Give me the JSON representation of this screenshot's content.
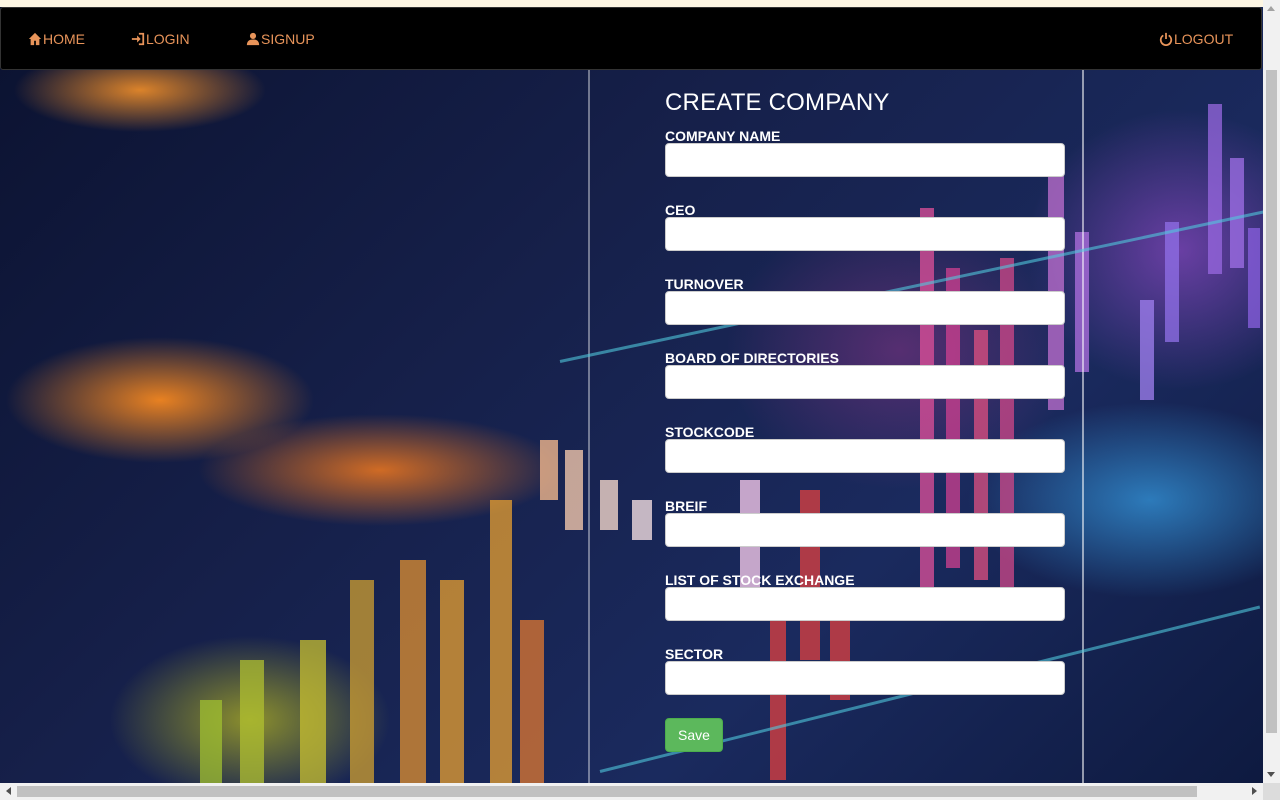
{
  "nav": {
    "home_label": "HOME",
    "login_label": "LOGIN",
    "signup_label": "SIGNUP",
    "logout_label": "LOGOUT",
    "link_color": "#e8945a",
    "icons": [
      "home-icon",
      "login-icon",
      "user-icon",
      "power-icon"
    ]
  },
  "form": {
    "title": "CREATE COMPANY",
    "fields": [
      {
        "label": "COMPANY NAME",
        "value": ""
      },
      {
        "label": "CEO",
        "value": ""
      },
      {
        "label": "TURNOVER",
        "value": ""
      },
      {
        "label": "BOARD OF DIRECTORIES",
        "value": ""
      },
      {
        "label": "STOCKCODE",
        "value": ""
      },
      {
        "label": "BREIF",
        "value": ""
      },
      {
        "label": "LIST OF STOCK EXCHANGE",
        "value": ""
      },
      {
        "label": "SECTOR",
        "value": ""
      }
    ],
    "save_label": "Save",
    "save_color": "#5cb85c"
  }
}
